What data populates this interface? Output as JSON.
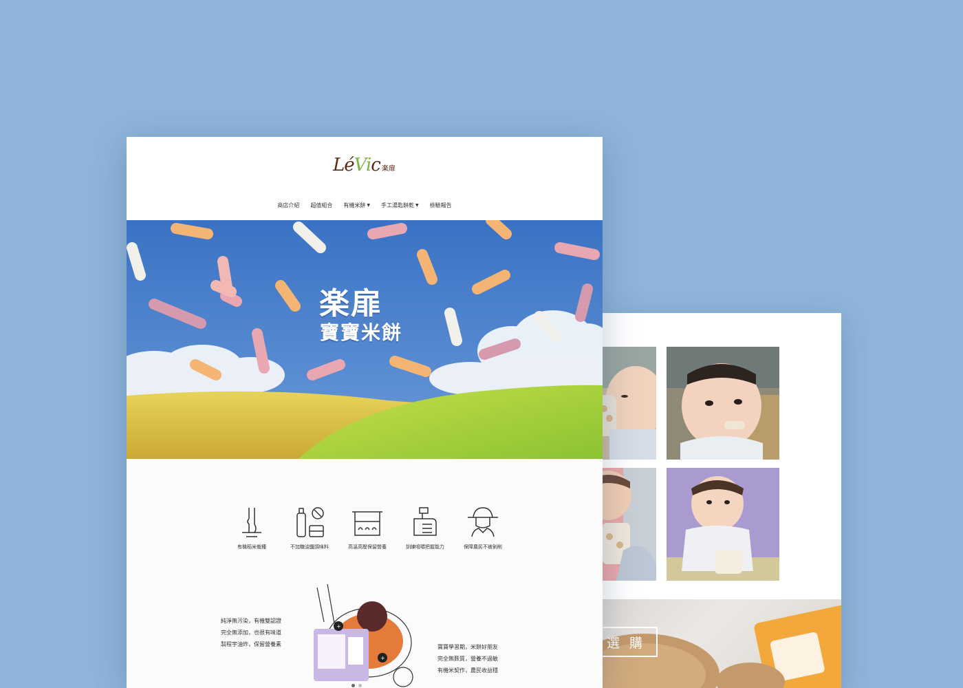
{
  "logo": {
    "script_text": "Lévic",
    "script_main": "Lé",
    "script_accent": "Vi",
    "script_end": "c",
    "cn_text": "楽扉"
  },
  "nav": {
    "items": [
      {
        "label": "商店介紹",
        "caret": false
      },
      {
        "label": "超值組合",
        "caret": false
      },
      {
        "label": "有機米餅",
        "caret": true
      },
      {
        "label": "手工湯匙餅乾",
        "caret": true
      },
      {
        "label": "檢驗報告",
        "caret": false
      }
    ]
  },
  "hero": {
    "title_line1": "楽扉",
    "title_line2": "寶寶米餅"
  },
  "features": [
    {
      "label": "有機稻米栽種",
      "icon": "rice-plant-icon"
    },
    {
      "label": "不加糖油鹽調味料",
      "icon": "no-seasoning-icon"
    },
    {
      "label": "高溫高壓保留營養",
      "icon": "pressure-cooker-icon"
    },
    {
      "label": "訓練咀嚼把握能力",
      "icon": "baby-hand-icon"
    },
    {
      "label": "保障農民不被剝削",
      "icon": "farmer-icon"
    }
  ],
  "left_text": [
    "純淨無污染，有機雙認證",
    "完全無添加，也很有味道",
    "製程宇油炸，保留營養素"
  ],
  "right_text": [
    "寶寶學習期，米餅好朋友",
    "完全無麩質，營養不過敏",
    "有機米契作，農民收益穩"
  ],
  "back_card": {
    "buy_button": "選 購"
  },
  "colors": {
    "background": "#8fb5da",
    "logo_brown": "#5a2a14",
    "logo_green": "#7cb342",
    "sky": "#3f78c8"
  }
}
